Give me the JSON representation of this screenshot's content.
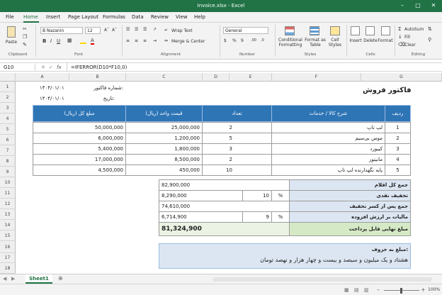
{
  "window": {
    "title": "Invoice.xlsx  -  Excel"
  },
  "menu": [
    "File",
    "Home",
    "Insert",
    "Page Layout",
    "Formulas",
    "Data",
    "Review",
    "View",
    "Help"
  ],
  "ribbon": {
    "clipboard": {
      "paste": "Paste",
      "label": "Clipboard"
    },
    "font": {
      "name": "B Nazanin",
      "size": "12",
      "label": "Font"
    },
    "alignment": {
      "wrap": "Wrap Text",
      "merge": "Merge & Center",
      "label": "Alignment"
    },
    "number": {
      "format": "General",
      "label": "Number"
    },
    "styles": {
      "conditional": "Conditional Formatting",
      "table": "Format as Table",
      "cell": "Cell Styles",
      "label": "Styles"
    },
    "cells": {
      "insert": "Insert",
      "delete": "Delete",
      "format": "Format",
      "label": "Cells"
    },
    "editing": {
      "autosum": "AutoSum",
      "fill": "Fill",
      "clear": "Clear",
      "label": "Editing"
    }
  },
  "formula_bar": {
    "name_box": "G10",
    "fx": "fx",
    "formula": "=IFERROR(D10*F10,0)"
  },
  "columns": [
    "A",
    "B",
    "C",
    "D",
    "E",
    "F",
    "G"
  ],
  "rows": [
    "1",
    "2",
    "3",
    "4",
    "5",
    "6",
    "7",
    "8",
    "9",
    "10",
    "11",
    "12",
    "13",
    "14",
    "15",
    "16",
    "17",
    "18"
  ],
  "invoice": {
    "title": "فاکتور فروش",
    "number_label": "شماره فاکتور:",
    "number_value": "۱۴۰۴/۰۱/۰۱",
    "date_label": "تاریخ:",
    "date_value": "۱۴۰۴/۰۱/۰۱",
    "headers": {
      "row": "ردیف",
      "desc": "شرح کالا / خدمات",
      "qty": "تعداد",
      "unit": "قیمت واحد (ریال)",
      "total": "مبلغ کل (ریال)"
    },
    "items": [
      {
        "row": "1",
        "desc": "لپ تاپ",
        "qty": "2",
        "unit": "25,000,000",
        "total": "50,000,000"
      },
      {
        "row": "2",
        "desc": "موس بی‌سیم",
        "qty": "5",
        "unit": "1,200,000",
        "total": "6,000,000"
      },
      {
        "row": "3",
        "desc": "کیبورد",
        "qty": "3",
        "unit": "1,800,000",
        "total": "5,400,000"
      },
      {
        "row": "4",
        "desc": "مانیتور",
        "qty": "2",
        "unit": "8,500,000",
        "total": "17,000,000"
      },
      {
        "row": "5",
        "desc": "پایه نگهدارنده لپ تاپ",
        "qty": "10",
        "unit": "450,000",
        "total": "4,500,000"
      }
    ],
    "summary": {
      "subtotal_label": "جمع کل اقلام",
      "subtotal": "82,900,000",
      "discount_label": "تخفیف نقدی",
      "discount_pct_sign": "%",
      "discount_pct": "10",
      "discount": "8,290,000",
      "after_discount_label": "جمع پس از کسر تخفیف",
      "after_discount": "74,610,000",
      "vat_label": "مالیات بر ارزش افزوده",
      "vat_pct_sign": "%",
      "vat_pct": "9",
      "vat": "6,714,900",
      "final_label": "مبلغ نهایی قابل پرداخت",
      "final": "81,324,900"
    },
    "words_label": "مبلغ به حروف:",
    "words_value": "هشتاد و یک میلیون و سیصد و بیست و چهار هزار و نهصد تومان"
  },
  "sheet_tab": "Sheet1",
  "status": {
    "zoom": "100%"
  },
  "colors": {
    "excel_green": "#217346",
    "header_blue": "#2e75b6",
    "summary_blue": "#dce6f2",
    "final_green": "#d6e9c6"
  }
}
